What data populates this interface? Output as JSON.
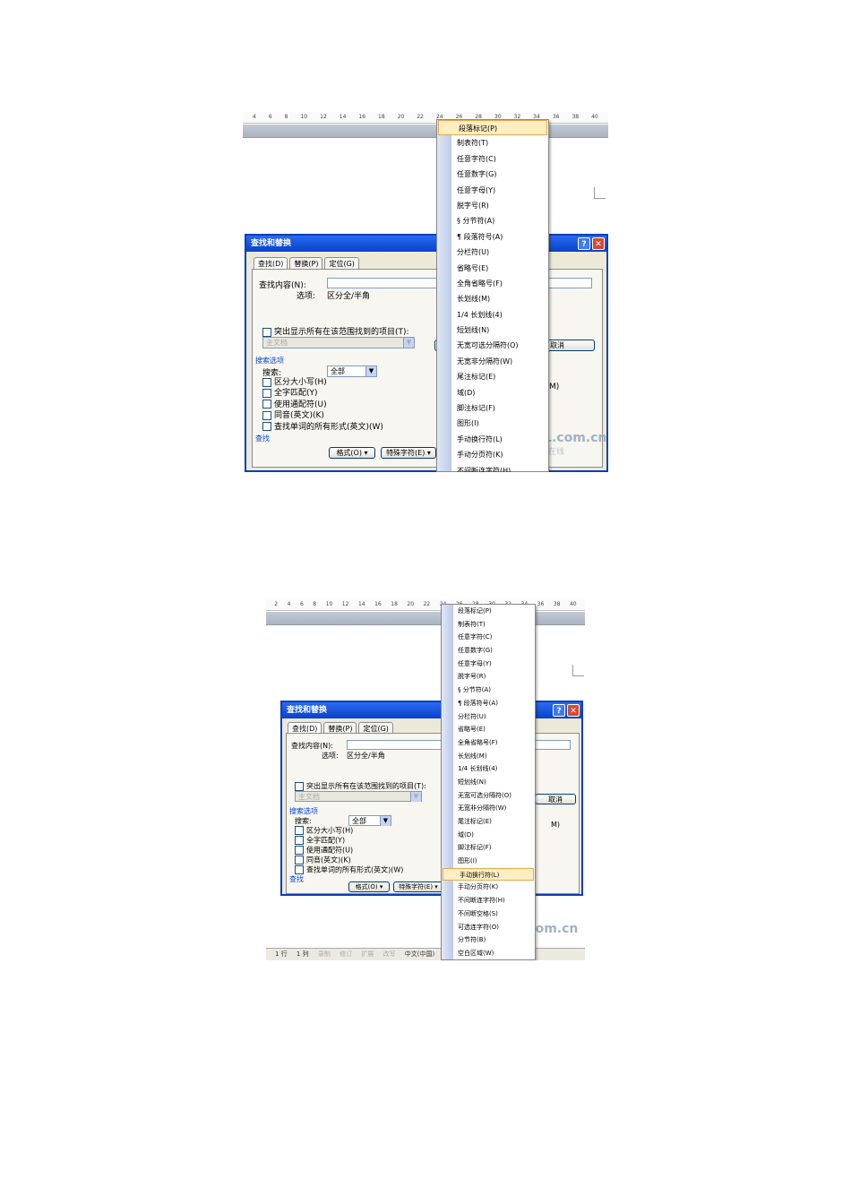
{
  "ruler_ticks": [
    "4",
    "6",
    "8",
    "10",
    "12",
    "14",
    "16",
    "18",
    "20",
    "22",
    "24",
    "26",
    "28",
    "30",
    "32",
    "34",
    "36",
    "38",
    "40"
  ],
  "ruler_ticks_2": [
    "2",
    "4",
    "6",
    "8",
    "10",
    "12",
    "14",
    "16",
    "18",
    "20",
    "22",
    "24",
    "26",
    "28",
    "30",
    "32",
    "34",
    "36",
    "38",
    "40"
  ],
  "dialog": {
    "title": "查找和替换",
    "help_glyph": "?",
    "close_glyph": "✕",
    "tabs": [
      "查找(D)",
      "替换(P)",
      "定位(G)"
    ],
    "find_label": "查找内容(N):",
    "options_label": "选项:",
    "options_value": "区分全/半角",
    "highlight_label": "突出显示所有在该范围找到的项目(T):",
    "scope_value": "主文档",
    "cancel_button": "取消",
    "search_options_title": "搜索选项",
    "search_label": "搜索:",
    "search_value": "全部",
    "checkboxes": [
      "区分大小写(H)",
      "全字匹配(Y)",
      "使用通配符(U)",
      "同音(英文)(K)",
      "查找单词的所有形式(英文)(W)"
    ],
    "find_section": "查找",
    "format_button": "格式(O) ▾",
    "special_button": "特殊字符(E) ▾",
    "cut_off_m": "M)"
  },
  "menu1": {
    "items": [
      "段落标记(P)",
      "制表符(T)",
      "任意字符(C)",
      "任意数字(G)",
      "任意字母(Y)",
      "脱字号(R)",
      "§ 分节符(A)",
      "¶ 段落符号(A)",
      "分栏符(U)",
      "省略号(E)",
      "全角省略号(F)",
      "长划线(M)",
      "1/4 长划线(4)",
      "短划线(N)",
      "无宽可选分隔符(O)",
      "无宽非分隔符(W)",
      "尾注标记(E)",
      "域(D)",
      "脚注标记(F)",
      "图形(I)",
      "手动换行符(L)",
      "手动分页符(K)",
      "不间断连字符(H)"
    ],
    "highlighted": 0
  },
  "menu2": {
    "items": [
      "段落标记(P)",
      "制表符(T)",
      "任意字符(C)",
      "任意数字(G)",
      "任意字母(Y)",
      "脱字号(R)",
      "§ 分节符(A)",
      "¶ 段落符号(A)",
      "分栏符(U)",
      "省略号(E)",
      "全角省略号(F)",
      "长划线(M)",
      "1/4 长划线(4)",
      "短划线(N)",
      "无宽可选分隔符(O)",
      "无宽非分隔符(W)",
      "尾注标记(E)",
      "域(D)",
      "脚注标记(F)",
      "图形(I)",
      "手动换行符(L)",
      "手动分页符(K)",
      "不间断连字符(H)",
      "不间断空格(S)",
      "可选连字符(O)",
      "分节符(B)",
      "空白区域(W)"
    ],
    "highlighted": 20
  },
  "watermark": {
    "site": "ZOL.com.cn",
    "cn": "中关村在线"
  },
  "statusbar": {
    "line": "1 行",
    "col": "1 列",
    "rec": "录制",
    "trk": "修订",
    "ext": "扩展",
    "ovr": "改写",
    "lang": "中文(中国)"
  }
}
